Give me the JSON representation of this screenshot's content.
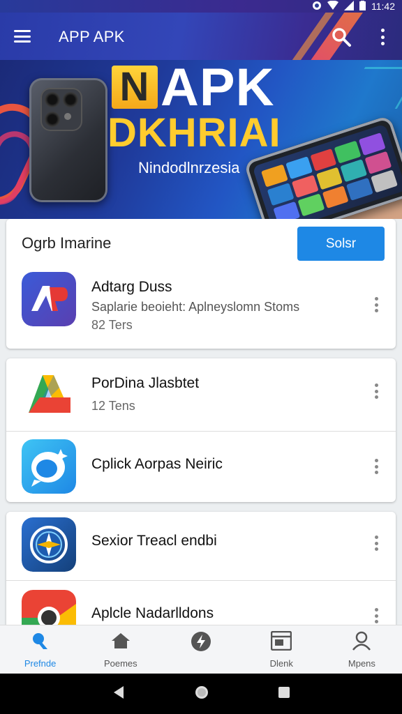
{
  "status_bar": {
    "time": "11:42"
  },
  "app_bar": {
    "title": "APP APK"
  },
  "banner": {
    "logo_letter": "N",
    "title_line1": "APK",
    "title_line2": "DKHRIAI",
    "subtitle": "Nindodlnrzesia"
  },
  "section": {
    "title": "Ogrb Imarine",
    "button_label": "Solsr"
  },
  "items": [
    {
      "title": "Adtarg Duss",
      "description": "Saplarie beoieht: Aplneyslomn Stoms",
      "meta": "82 Ters"
    },
    {
      "title": "PorDina Jlasbtet",
      "description": "",
      "meta": "12 Tens"
    },
    {
      "title": "Cplick Aorpas Neiric",
      "description": "",
      "meta": ""
    },
    {
      "title": "Sexior Treacl endbi",
      "description": "",
      "meta": ""
    },
    {
      "title": "Aplcle Nadarlldons",
      "description": "",
      "meta": ""
    }
  ],
  "bottom_nav": [
    {
      "label": "Prefnde",
      "icon": "home-icon",
      "active": true
    },
    {
      "label": "Poemes",
      "icon": "store-icon",
      "active": false
    },
    {
      "label": "",
      "icon": "bolt-icon",
      "active": false
    },
    {
      "label": "Dlenk",
      "icon": "browser-icon",
      "active": false
    },
    {
      "label": "Mpens",
      "icon": "person-icon",
      "active": false
    }
  ],
  "colors": {
    "primary": "#1e88e5",
    "accent_yellow": "#ffcc2e"
  }
}
